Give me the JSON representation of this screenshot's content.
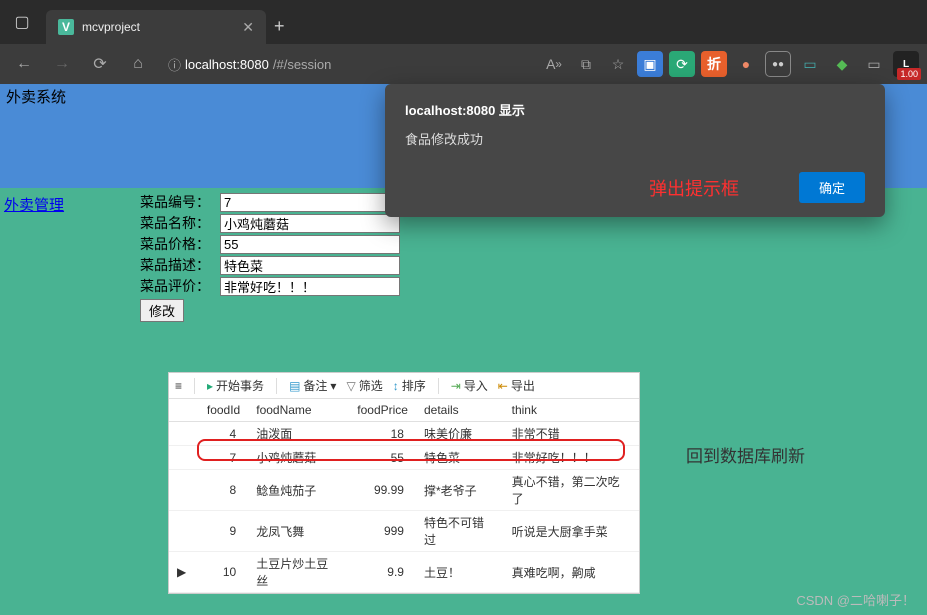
{
  "browser": {
    "tab_title": "mcvproject",
    "tab_fav_letter": "V",
    "url_host": "localhost:8080",
    "url_path": "/#/session",
    "ext_badge": "1.00"
  },
  "header": {
    "title": "外卖系统"
  },
  "sidebar": {
    "link": "外卖管理"
  },
  "form": {
    "labels": {
      "id": "菜品编号：",
      "name": "菜品名称：",
      "price": "菜品价格：",
      "desc": "菜品描述：",
      "review": "菜品评价："
    },
    "values": {
      "id": "7",
      "name": "小鸡炖蘑菇",
      "price": "55",
      "desc": "特色菜",
      "review": "非常好吃！！！"
    },
    "submit": "修改"
  },
  "alert": {
    "title": "localhost:8080 显示",
    "message": "食品修改成功",
    "annotation": "弹出提示框",
    "ok": "确定"
  },
  "db": {
    "toolbar": {
      "begin": "开始事务",
      "remark": "备注",
      "filter": "筛选",
      "sort": "排序",
      "import": "导入",
      "export": "导出"
    },
    "columns": [
      "foodId",
      "foodName",
      "foodPrice",
      "details",
      "think"
    ],
    "rows": [
      {
        "foodId": 4,
        "foodName": "油泼面",
        "foodPrice": "18",
        "details": "味美价廉",
        "think": "非常不错"
      },
      {
        "foodId": 7,
        "foodName": "小鸡炖蘑菇",
        "foodPrice": "55",
        "details": "特色菜",
        "think": "非常好吃！！！"
      },
      {
        "foodId": 8,
        "foodName": "鲶鱼炖茄子",
        "foodPrice": "99.99",
        "details": "撑*老爷子",
        "think": "真心不错，第二次吃了"
      },
      {
        "foodId": 9,
        "foodName": "龙凤飞舞",
        "foodPrice": "999",
        "details": "特色不可错过",
        "think": "听说是大厨拿手菜"
      },
      {
        "foodId": 10,
        "foodName": "土豆片炒土豆丝",
        "foodPrice": "9.9",
        "details": "土豆！",
        "think": "真难吃啊，齁咸"
      }
    ]
  },
  "annotation_side": "回到数据库刷新",
  "watermark": "CSDN @二哈喇子！"
}
